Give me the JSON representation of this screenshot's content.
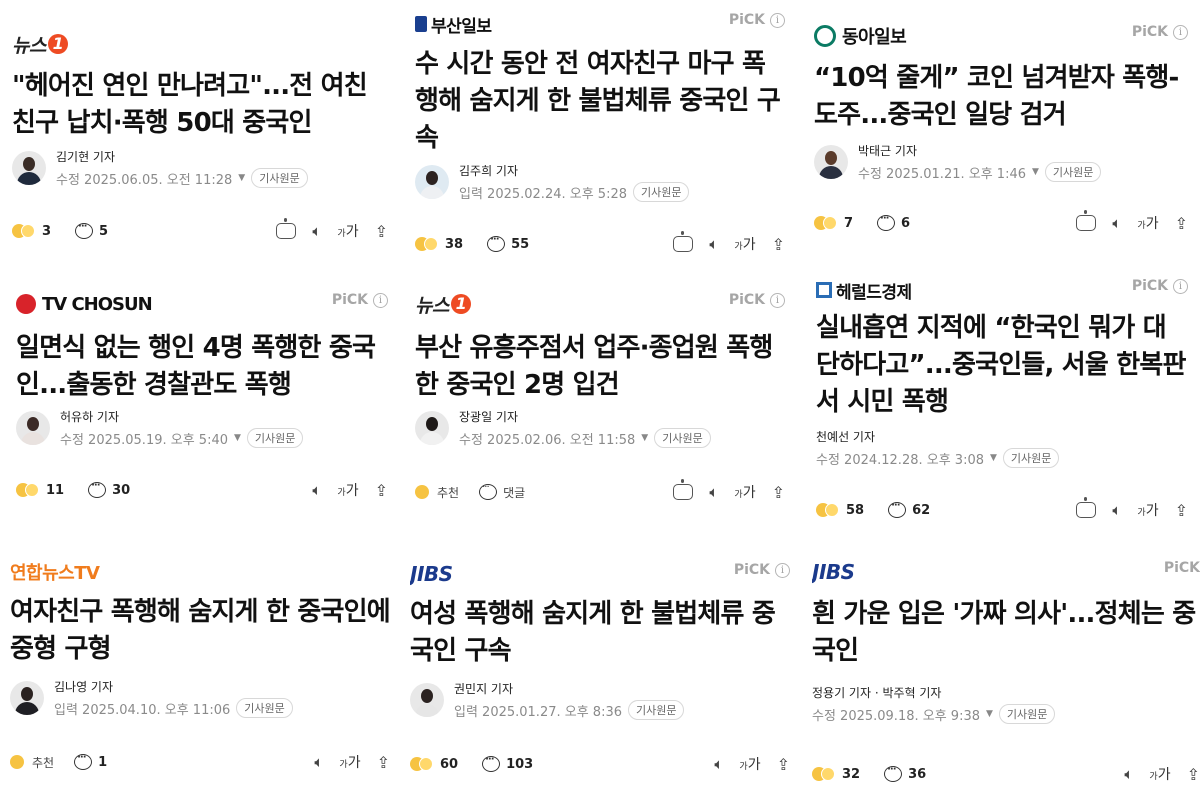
{
  "cards": [
    {
      "publisher": "뉴스",
      "publisher_mark": "1",
      "pick": "",
      "title": "\"헤어진 연인 만나려고\"...전 여친 친구 납치·폭행 50대 중국인",
      "reporter": "김기현 기자",
      "date": "수정 2025.06.05. 오전 11:28",
      "orig": "기사원문",
      "reactions": "3",
      "comments": "5",
      "font_label": "가",
      "font_small": "가"
    },
    {
      "publisher": "부산일보",
      "publisher_mark": "",
      "pick": "PiCK",
      "title": "수 시간 동안 전 여자친구 마구 폭행해 숨지게 한 불법체류 중국인 구속",
      "reporter": "김주희 기자",
      "date": "입력 2025.02.24. 오후 5:28",
      "orig": "기사원문",
      "reactions": "38",
      "comments": "55",
      "font_label": "가",
      "font_small": "가"
    },
    {
      "publisher": "동아일보",
      "publisher_mark": "",
      "pick": "PiCK",
      "title": "“10억 줄게” 코인 넘겨받자 폭행-도주...중국인 일당 검거",
      "reporter": "박태근 기자",
      "date": "수정 2025.01.21. 오후 1:46",
      "orig": "기사원문",
      "reactions": "7",
      "comments": "6",
      "font_label": "가",
      "font_small": "가"
    },
    {
      "publisher": "TV CHOSUN",
      "publisher_mark": "",
      "pick": "PiCK",
      "title": "일면식 없는 행인 4명 폭행한 중국인...출동한 경찰관도 폭행",
      "reporter": "허유하 기자",
      "date": "수정 2025.05.19. 오후 5:40",
      "orig": "기사원문",
      "reactions": "11",
      "comments": "30",
      "font_label": "가",
      "font_small": "가"
    },
    {
      "publisher": "뉴스",
      "publisher_mark": "1",
      "pick": "PiCK",
      "title": "부산 유흥주점서 업주·종업원 폭행한 중국인 2명 입건",
      "reporter": "장광일 기자",
      "date": "수정 2025.02.06. 오전 11:58",
      "orig": "기사원문",
      "reactions": "추천",
      "comments": "댓글",
      "font_label": "가",
      "font_small": "가"
    },
    {
      "publisher": "헤럴드경제",
      "publisher_mark": "",
      "pick": "PiCK",
      "title": "실내흡연 지적에 “한국인 뭐가 대단하다고”...중국인들, 서울 한복판서 시민 폭행",
      "reporter": "천예선 기자",
      "date": "수정 2024.12.28. 오후 3:08",
      "orig": "기사원문",
      "reactions": "58",
      "comments": "62",
      "font_label": "가",
      "font_small": "가"
    },
    {
      "publisher": "연합뉴스TV",
      "publisher_mark": "",
      "pick": "",
      "title": "여자친구 폭행해 숨지게 한 중국인에 중형 구형",
      "reporter": "김나영 기자",
      "date": "입력 2025.04.10. 오후 11:06",
      "orig": "기사원문",
      "reactions": "추천",
      "comments": "1",
      "font_label": "가",
      "font_small": "가"
    },
    {
      "publisher": "JIBS",
      "publisher_mark": "",
      "pick": "PiCK",
      "title": "여성 폭행해 숨지게 한 불법체류 중국인 구속",
      "reporter": "권민지 기자",
      "date": "입력 2025.01.27. 오후 8:36",
      "orig": "기사원문",
      "reactions": "60",
      "comments": "103",
      "font_label": "가",
      "font_small": "가"
    },
    {
      "publisher": "JIBS",
      "publisher_mark": "",
      "pick": "PiCK",
      "title": "흰 가운 입은 '가짜 의사'...정체는 중국인",
      "reporter": "정용기 기자 · 박주혁 기자",
      "date": "수정 2025.09.18. 오후 9:38",
      "orig": "기사원문",
      "reactions": "32",
      "comments": "36",
      "font_label": "가",
      "font_small": "가"
    }
  ],
  "colors": {
    "news1_orange": "#ee4b23",
    "busan_blue": "#1a3f8f",
    "donga_green": "#0b7b64",
    "tvchosun_red": "#d8232a",
    "herald_blue": "#2a6db5",
    "yonhap_orange": "#f07c1d",
    "jibs_navy": "#1b3a8c",
    "pick_gray": "#a6a6a6"
  },
  "icons": [
    "reaction-emoji-icon",
    "comment-icon",
    "ai-summary-robot-icon",
    "speaker-icon",
    "font-size-icon",
    "share-icon",
    "info-icon",
    "chevron-down-icon"
  ]
}
